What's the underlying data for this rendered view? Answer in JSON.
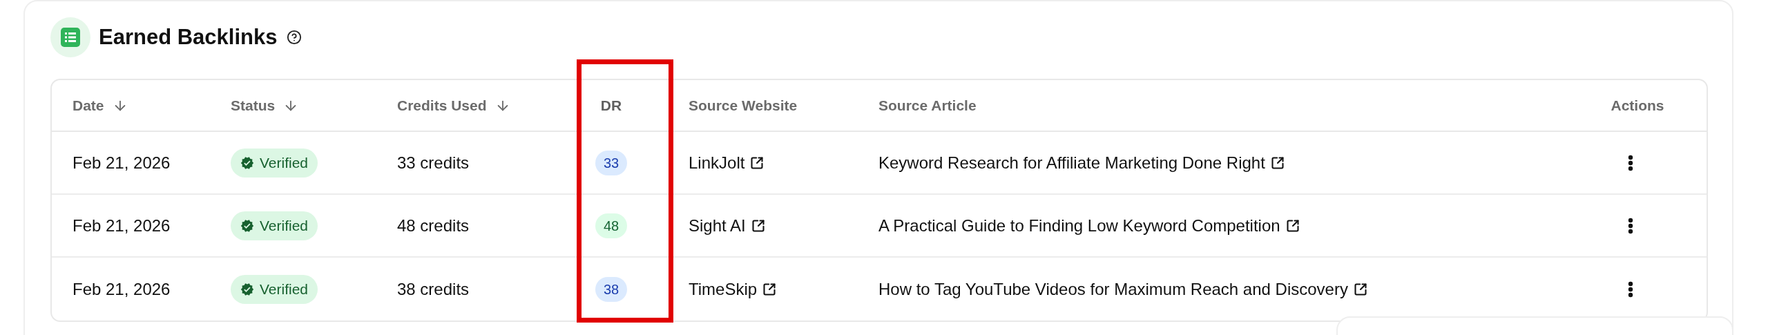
{
  "section": {
    "title": "Earned Backlinks"
  },
  "table": {
    "columns": [
      {
        "label": "Date",
        "sortable": true,
        "highlighted": false
      },
      {
        "label": "Status",
        "sortable": true,
        "highlighted": false
      },
      {
        "label": "Credits Used",
        "sortable": true,
        "highlighted": false
      },
      {
        "label": "DR",
        "sortable": false,
        "highlighted": true
      },
      {
        "label": "Source Website",
        "sortable": false,
        "highlighted": false
      },
      {
        "label": "Source Article",
        "sortable": false,
        "highlighted": false
      },
      {
        "label": "Actions",
        "sortable": false,
        "highlighted": false
      }
    ],
    "rows": [
      {
        "date": "Feb 21, 2026",
        "status": "Verified",
        "credits": "33 credits",
        "dr": {
          "value": "33",
          "color": "#1e40af"
        },
        "website": "LinkJolt",
        "article": "Keyword Research for Affiliate Marketing Done Right"
      },
      {
        "date": "Feb 21, 2026",
        "status": "Verified",
        "credits": "48 credits",
        "dr": {
          "value": "48",
          "color": "#166534"
        },
        "website": "Sight AI",
        "article": "A Practical Guide to Finding Low Keyword Competition"
      },
      {
        "date": "Feb 21, 2026",
        "status": "Verified",
        "credits": "38 credits",
        "dr": {
          "value": "38",
          "color": "#1e40af"
        },
        "website": "TimeSkip",
        "article": "How to Tag YouTube Videos for Maximum Reach and Discovery"
      }
    ]
  }
}
